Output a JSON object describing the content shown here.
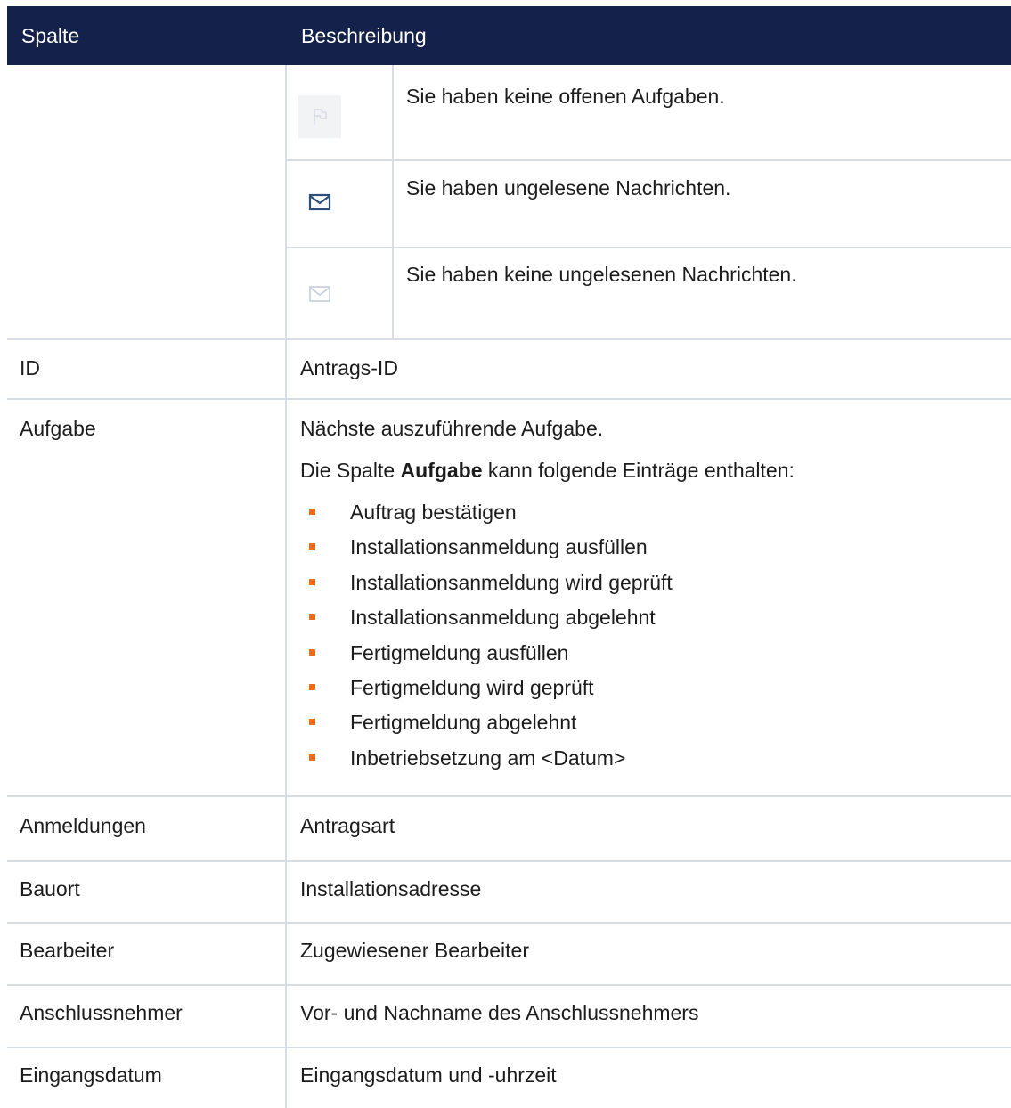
{
  "header": {
    "col1": "Spalte",
    "col2": "Beschreibung"
  },
  "icon_rows": [
    {
      "icon": "flag-icon",
      "text": "Sie haben keine offenen Aufgaben."
    },
    {
      "icon": "envelope-icon",
      "icon_color": "#2d4f7a",
      "text": "Sie haben ungelesene Nachrichten."
    },
    {
      "icon": "envelope-icon",
      "icon_color": "#c9d3df",
      "text": "Sie haben keine ungelesenen Nachrichten."
    }
  ],
  "rows": {
    "id": {
      "col": "ID",
      "desc": "Antrags-ID"
    },
    "aufgabe": {
      "col": "Aufgabe",
      "desc": "Nächste auszuführende Aufgabe.",
      "intro_prefix": "Die Spalte ",
      "intro_bold": "Aufgabe",
      "intro_suffix": " kann folgende Einträge enthalten:",
      "items": [
        "Auftrag bestätigen",
        "Installationsanmeldung ausfüllen",
        "Installationsanmeldung wird geprüft",
        "Installationsanmeldung abgelehnt",
        "Fertigmeldung ausfüllen",
        "Fertigmeldung wird geprüft",
        "Fertigmeldung abgelehnt",
        "Inbetriebsetzung am <Datum>"
      ]
    },
    "anmeldungen": {
      "col": "Anmeldungen",
      "desc": "Antragsart"
    },
    "bauort": {
      "col": "Bauort",
      "desc": "Installationsadresse"
    },
    "bearbeiter": {
      "col": "Bearbeiter",
      "desc": "Zugewiesener Bearbeiter"
    },
    "anschlussnehmer": {
      "col": "Anschlussnehmer",
      "desc": "Vor- und Nachname des Anschlussnehmers"
    },
    "eingangsdatum": {
      "col": "Eingangsdatum",
      "desc": "Eingangsdatum und -uhrzeit"
    }
  },
  "colors": {
    "header_bg": "#14214b",
    "bullet": "#f06a1a",
    "grid": "#d7dde4"
  }
}
